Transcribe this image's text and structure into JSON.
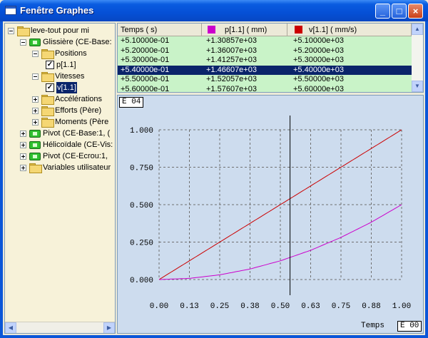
{
  "window": {
    "title": "Fenêtre Graphes",
    "minimize": "_",
    "maximize": "□",
    "close": "×"
  },
  "tree": [
    {
      "label": "leve-tout pour mi",
      "kind": "folder",
      "expander": "minus",
      "depth": 0
    },
    {
      "label": "Glissière (CE-Base:",
      "kind": "joint",
      "expander": "minus",
      "depth": 1
    },
    {
      "label": "Positions",
      "kind": "folder",
      "expander": "minus",
      "depth": 2
    },
    {
      "label": "p[1.1]",
      "kind": "check",
      "checked": "☑",
      "depth": 3
    },
    {
      "label": "Vitesses",
      "kind": "folder",
      "expander": "minus",
      "depth": 2
    },
    {
      "label": "v[1.1]",
      "kind": "check",
      "checked": "☑",
      "depth": 3,
      "selected": true
    },
    {
      "label": "Accélérations",
      "kind": "folder",
      "expander": "plus",
      "depth": 2
    },
    {
      "label": "Efforts (Père)",
      "kind": "folder",
      "expander": "plus",
      "depth": 2
    },
    {
      "label": "Moments (Père",
      "kind": "folder",
      "expander": "plus",
      "depth": 2
    },
    {
      "label": "Pivot (CE-Base:1, (",
      "kind": "joint",
      "expander": "plus",
      "depth": 1
    },
    {
      "label": "Hélicoïdale (CE-Vis:",
      "kind": "joint",
      "expander": "plus",
      "depth": 1
    },
    {
      "label": "Pivot (CE-Ecrou:1,",
      "kind": "joint",
      "expander": "plus",
      "depth": 1
    },
    {
      "label": "Variables utilisateur",
      "kind": "folder",
      "expander": "plus",
      "depth": 1
    }
  ],
  "table": {
    "headers": [
      "Temps ( s)",
      "p[1.1] ( mm)",
      "v[1.1] ( mm/s)"
    ],
    "header_colors": [
      "",
      "#cc00cc",
      "#cc0000"
    ],
    "rows": [
      [
        "+5.10000e-01",
        "+1.30857e+03",
        "+5.10000e+03"
      ],
      [
        "+5.20000e-01",
        "+1.36007e+03",
        "+5.20000e+03"
      ],
      [
        "+5.30000e-01",
        "+1.41257e+03",
        "+5.30000e+03"
      ],
      [
        "+5.40000e-01",
        "+1.46607e+03",
        "+5.40000e+03"
      ],
      [
        "+5.50000e-01",
        "+1.52057e+03",
        "+5.50000e+03"
      ],
      [
        "+5.60000e-01",
        "+1.57607e+03",
        "+5.60000e+03"
      ]
    ],
    "selected_row": 3
  },
  "plot": {
    "y_exponent": "E 04",
    "x_exponent": "E 00",
    "x_title": "Temps",
    "y_ticks": [
      "1.000",
      "0.750",
      "0.500",
      "0.250",
      "0.000"
    ],
    "x_ticks": [
      "0.00",
      "0.13",
      "0.25",
      "0.38",
      "0.50",
      "0.63",
      "0.75",
      "0.88",
      "1.00"
    ],
    "cursor_x": 0.54
  },
  "chart_data": {
    "type": "line",
    "xlabel": "Temps",
    "xlim": [
      0,
      1
    ],
    "ylim": [
      0,
      1
    ],
    "x": [
      0,
      0.125,
      0.25,
      0.375,
      0.5,
      0.625,
      0.75,
      0.875,
      1.0
    ],
    "series": [
      {
        "name": "v[1.1]",
        "color": "#cc0000",
        "values": [
          0,
          0.125,
          0.25,
          0.375,
          0.5,
          0.625,
          0.75,
          0.875,
          1.0
        ]
      },
      {
        "name": "p[1.1]",
        "color": "#cc00cc",
        "values": [
          0,
          0.0078,
          0.0313,
          0.0703,
          0.125,
          0.1953,
          0.2813,
          0.3828,
          0.5
        ]
      }
    ],
    "grid": true
  }
}
